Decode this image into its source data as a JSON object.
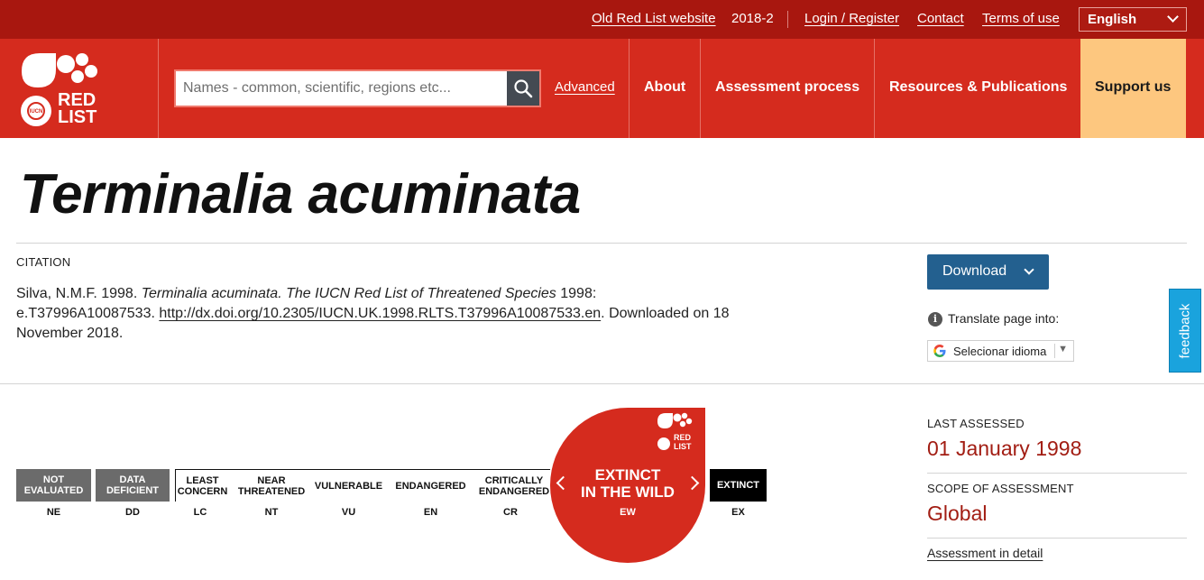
{
  "topbar": {
    "old_site": "Old Red List website",
    "version": "2018-2",
    "login": "Login / Register",
    "contact": "Contact",
    "terms": "Terms of use",
    "language": "English"
  },
  "header": {
    "logo_text_1": "RED",
    "logo_text_2": "LIST",
    "logo_small": "IUCN",
    "search_placeholder": "Names - common, scientific, regions etc...",
    "advanced": "Advanced",
    "nav": [
      "About",
      "Assessment process",
      "Resources & Publications"
    ],
    "support": "Support us"
  },
  "species": {
    "title": "Terminalia acuminata"
  },
  "citation": {
    "label": "CITATION",
    "author_year": "Silva, N.M.F. 1998. ",
    "italic": "Terminalia acuminata. The IUCN Red List of Threatened Species",
    "after_italic": " 1998: e.T37996A10087533. ",
    "doi": "http://dx.doi.org/10.2305/IUCN.UK.1998.RLTS.T37996A10087533.en",
    "downloaded": ". Downloaded on 18 November 2018."
  },
  "tools": {
    "download": "Download",
    "translate": "Translate page into:",
    "select_language": "Selecionar idioma",
    "info": "i",
    "feedback": "feedback"
  },
  "categories": [
    {
      "line1": "NOT",
      "line2": "EVALUATED",
      "abbr": "NE"
    },
    {
      "line1": "DATA",
      "line2": "DEFICIENT",
      "abbr": "DD"
    },
    {
      "line1": "LEAST",
      "line2": "CONCERN",
      "abbr": "LC"
    },
    {
      "line1": "NEAR",
      "line2": "THREATENED",
      "abbr": "NT"
    },
    {
      "line1": "VULNERABLE",
      "line2": "",
      "abbr": "VU"
    },
    {
      "line1": "ENDANGERED",
      "line2": "",
      "abbr": "EN"
    },
    {
      "line1": "CRITICALLY",
      "line2": "ENDANGERED",
      "abbr": "CR"
    },
    {
      "line1": "EXTINCT",
      "line2": "",
      "abbr": "EX"
    }
  ],
  "current_category": {
    "line1": "EXTINCT",
    "line2": "IN THE WILD",
    "abbr": "EW",
    "logo_text_1": "RED",
    "logo_text_2": "LIST"
  },
  "assessment": {
    "last_assessed_label": "LAST ASSESSED",
    "last_assessed_value": "01 January 1998",
    "scope_label": "SCOPE OF ASSESSMENT",
    "scope_value": "Global",
    "detail_link": "Assessment in detail"
  },
  "colors": {
    "brand_red": "#d52b1e",
    "dark_red": "#a8170f",
    "support_bg": "#fdc77f",
    "download_blue": "#23608f",
    "feedback_blue": "#1aa3dd",
    "value_red": "#a21d13"
  }
}
